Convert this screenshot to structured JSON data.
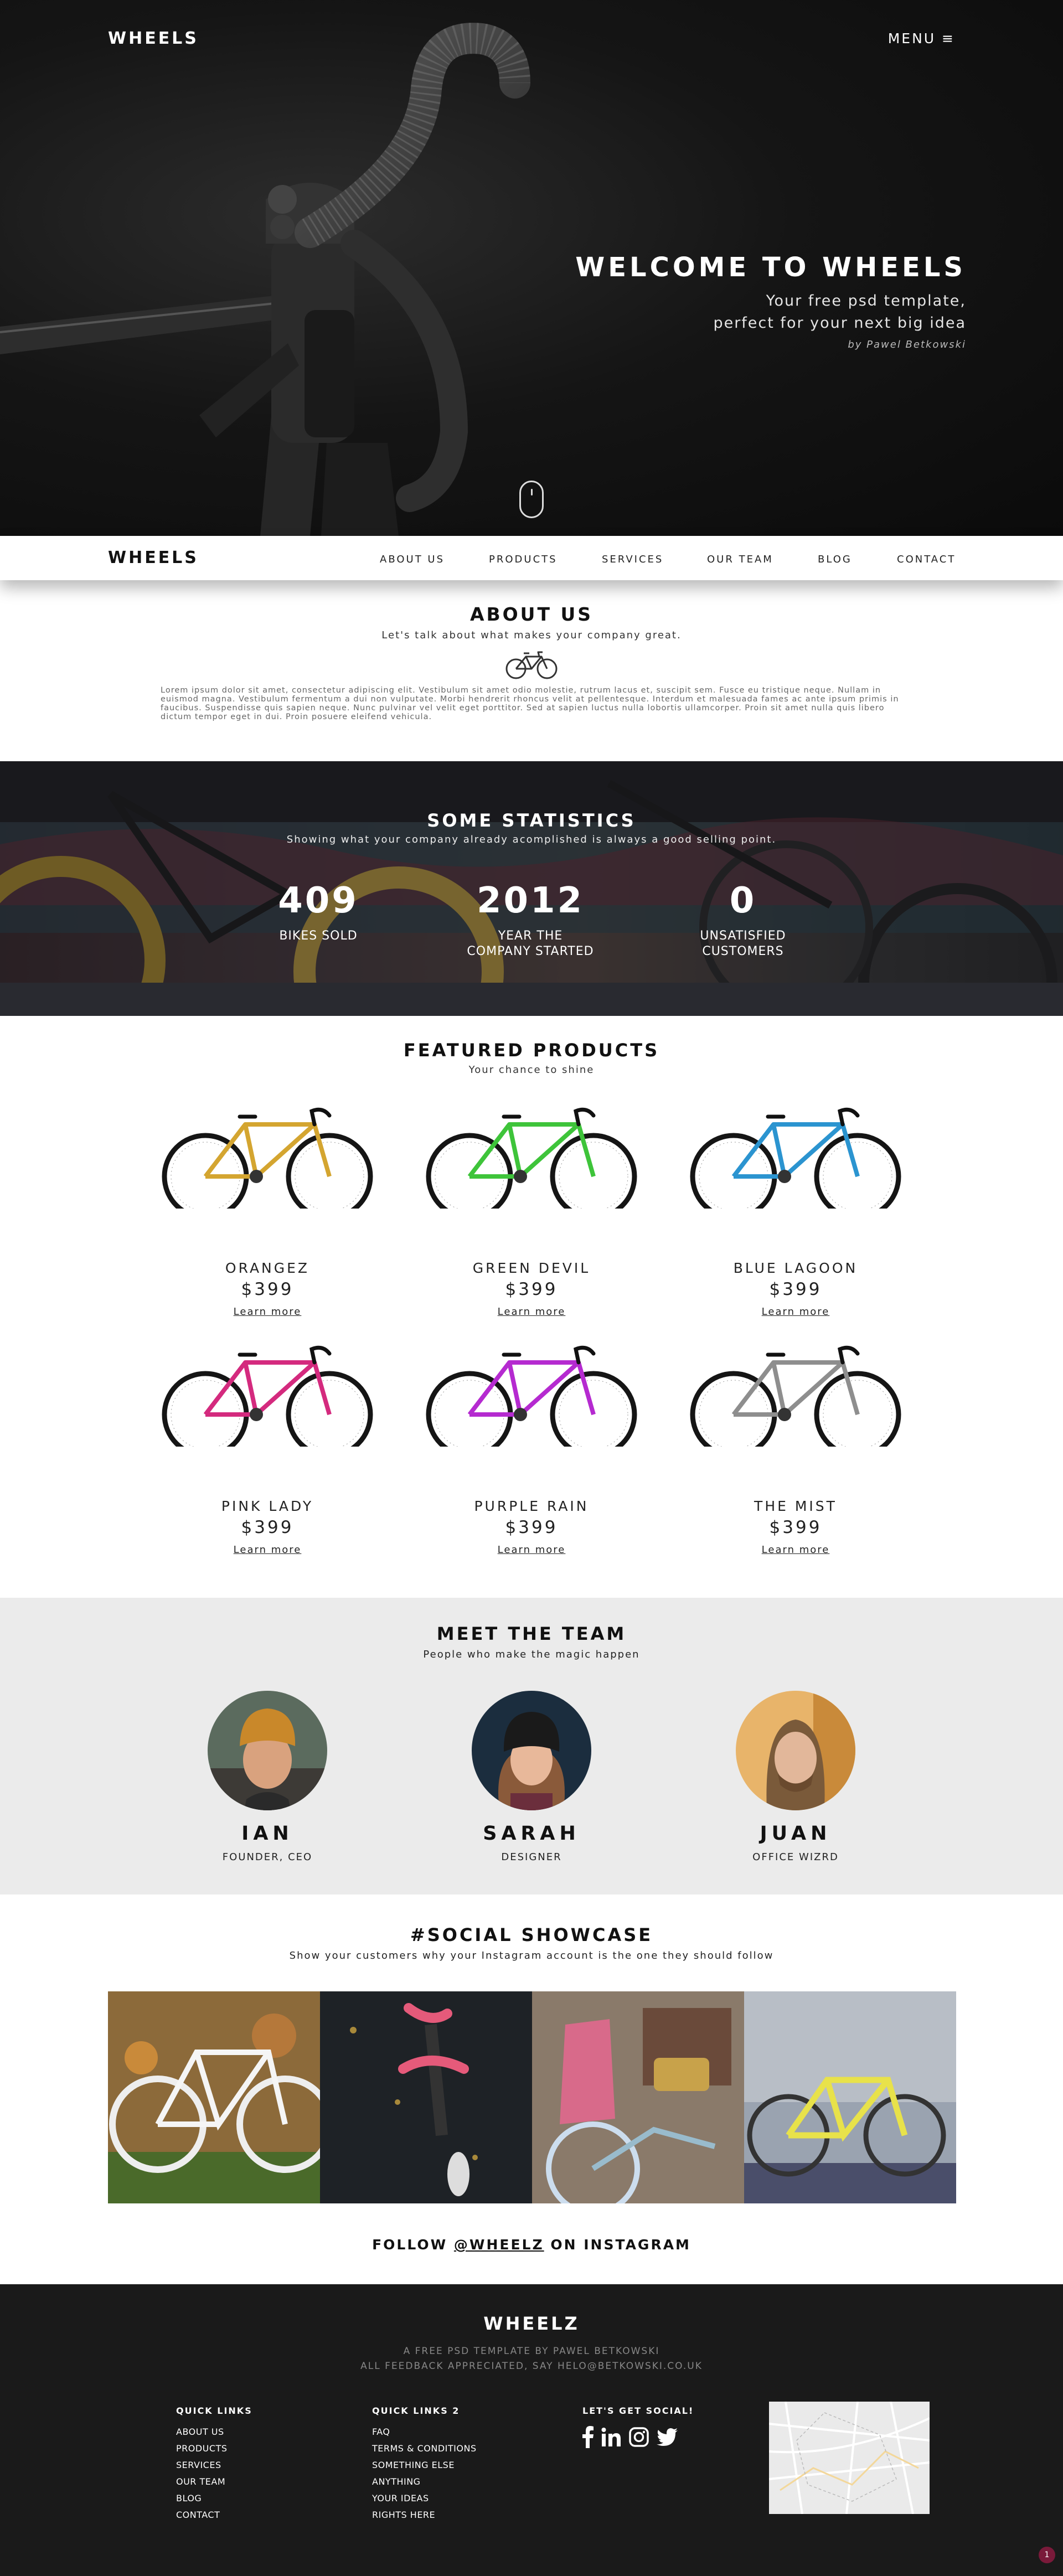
{
  "header": {
    "logo": "WHEELS",
    "menu_label": "MENU ≡"
  },
  "hero": {
    "title": "WELCOME TO WHEELS",
    "subtitle_line1": "Your free psd template,",
    "subtitle_line2": "perfect for your next big idea",
    "byline": "by Pawel Betkowski"
  },
  "nav": {
    "logo": "WHEELS",
    "items": [
      "ABOUT US",
      "PRODUCTS",
      "SERVICES",
      "OUR TEAM",
      "BLOG",
      "CONTACT"
    ]
  },
  "about": {
    "title": "ABOUT US",
    "subtitle": "Let's talk about what makes your company great.",
    "icon": "bicycle-icon",
    "body": "Lorem ipsum dolor sit amet, consectetur adipiscing elit. Vestibulum sit amet odio molestie, rutrum lacus et, suscipit sem. Fusce eu tristique neque. Nullam in euismod magna. Vestibulum fermentum a dui non vulputate. Morbi hendrerit rhoncus velit at pellentesque. Interdum et malesuada fames ac ante ipsum primis in faucibus. Suspendisse quis sapien neque. Nunc pulvinar vel velit eget porttitor. Sed at sapien luctus nulla lobortis ullamcorper. Proin sit amet nulla quis libero dictum tempor eget in dui. Proin posuere eleifend vehicula."
  },
  "stats": {
    "title": "SOME STATISTICS",
    "subtitle": "Showing what your company already acomplished is always a good selling point.",
    "items": [
      {
        "number": "409",
        "label_line1": "BIKES SOLD",
        "label_line2": ""
      },
      {
        "number": "2012",
        "label_line1": "YEAR THE",
        "label_line2": "COMPANY STARTED"
      },
      {
        "number": "0",
        "label_line1": "UNSATISFIED",
        "label_line2": "CUSTOMERS"
      }
    ]
  },
  "products": {
    "title": "FEATURED PRODUCTS",
    "subtitle": "Your chance to shine",
    "items": [
      {
        "name": "ORANGEZ",
        "price": "$399",
        "link": "Learn more",
        "color": "#d4a530"
      },
      {
        "name": "GREEN DEVIL",
        "price": "$399",
        "link": "Learn more",
        "color": "#3ec43a"
      },
      {
        "name": "BLUE LAGOON",
        "price": "$399",
        "link": "Learn more",
        "color": "#2b94d0"
      },
      {
        "name": "PINK LADY",
        "price": "$399",
        "link": "Learn more",
        "color": "#d42a7e"
      },
      {
        "name": "PURPLE RAIN",
        "price": "$399",
        "link": "Learn more",
        "color": "#b52ad0"
      },
      {
        "name": "THE MIST",
        "price": "$399",
        "link": "Learn more",
        "color": "#8e8e8e"
      }
    ]
  },
  "team": {
    "title": "MEET THE TEAM",
    "subtitle": "People who make the magic happen",
    "members": [
      {
        "name": "IAN",
        "role": "FOUNDER, CEO"
      },
      {
        "name": "SARAH",
        "role": "DESIGNER"
      },
      {
        "name": "JUAN",
        "role": "OFFICE WIZRD"
      }
    ]
  },
  "social": {
    "title": "#SOCIAL SHOWCASE",
    "subtitle": "Show your customers why your Instagram account is the one they should follow",
    "follow_prefix": "FOLLOW",
    "follow_handle": "@WHEELZ",
    "follow_suffix": "ON INSTAGRAM"
  },
  "footer": {
    "logo": "WHEELZ",
    "line1": "A FREE PSD TEMPLATE BY PAWEL BETKOWSKI",
    "line2": "ALL FEEDBACK APPRECIATED, SAY HELO@BETKOWSKI.CO.UK",
    "col1": {
      "heading": "QUICK LINKS",
      "links": [
        "ABOUT US",
        "PRODUCTS",
        "SERVICES",
        "OUR TEAM",
        "BLOG",
        "CONTACT"
      ]
    },
    "col2": {
      "heading": "QUICK LINKS 2",
      "links": [
        "FAQ",
        "TERMS & CONDITIONS",
        "SOMETHING ELSE",
        "ANYTHING",
        "YOUR IDEAS",
        "RIGHTS HERE"
      ]
    },
    "col3": {
      "heading": "LET'S GET SOCIAL!",
      "icons": [
        "facebook-icon",
        "linkedin-icon",
        "instagram-icon",
        "twitter-icon"
      ]
    },
    "badge": "1"
  }
}
